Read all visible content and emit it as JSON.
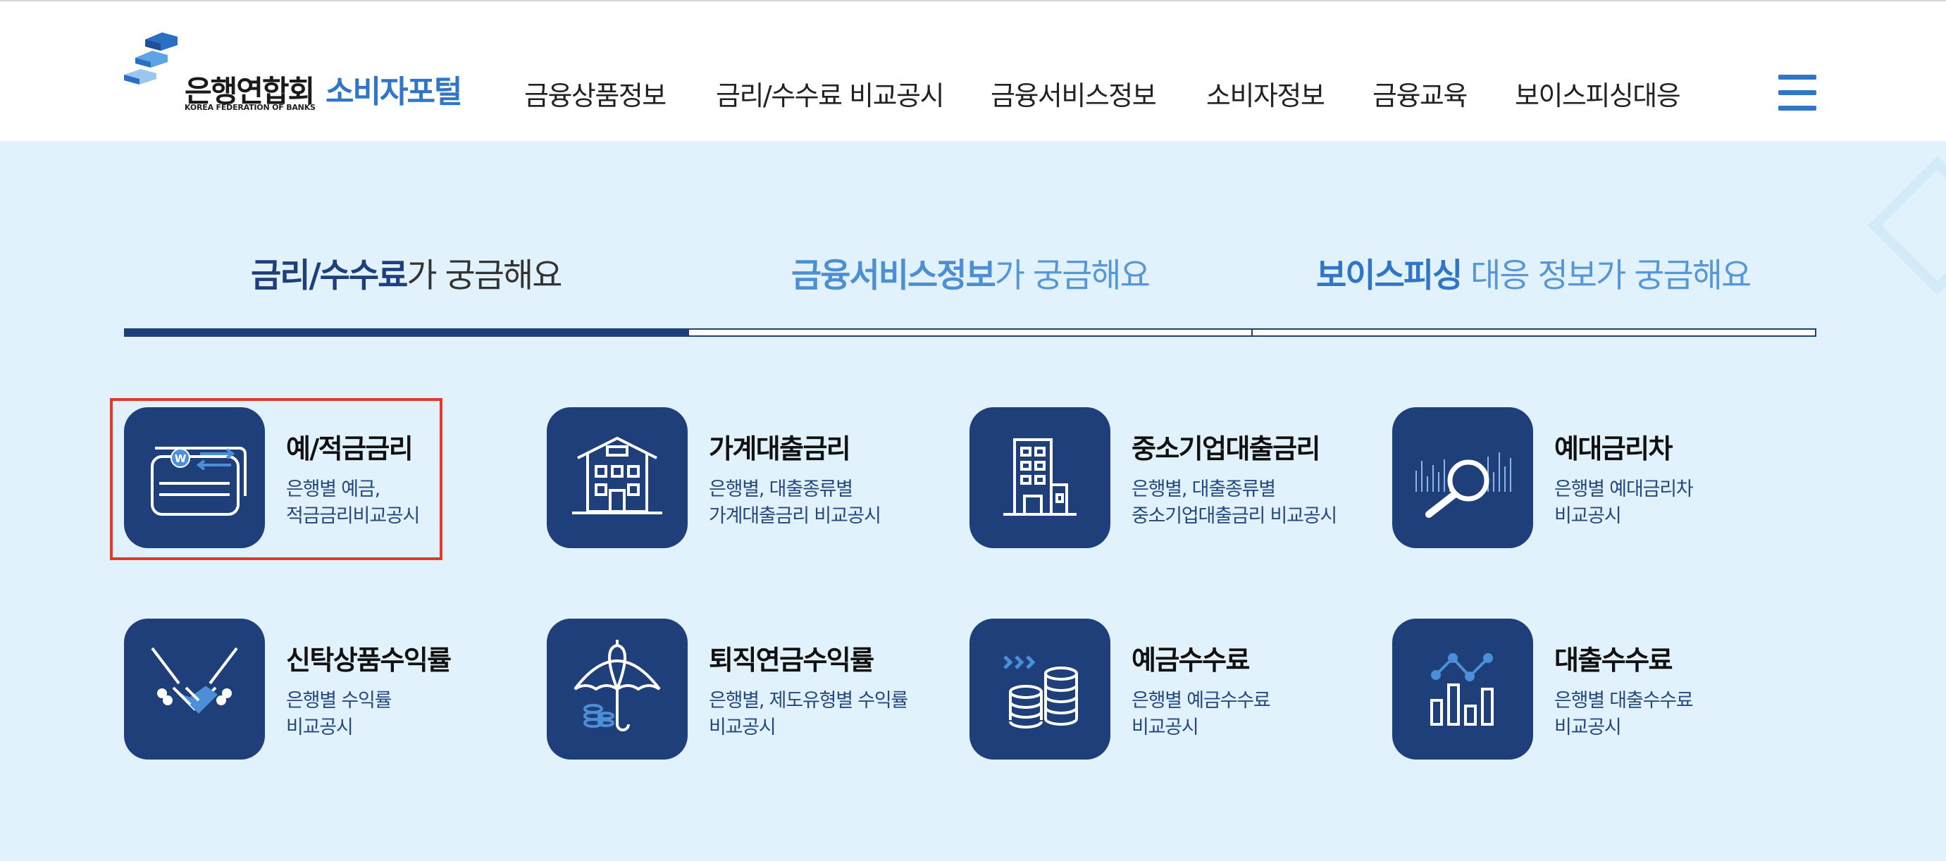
{
  "header": {
    "logo": {
      "name": "은행연합회",
      "subtitle": "KOREA FEDERATION OF BANKS",
      "portal": "소비자포털"
    },
    "nav": [
      "금융상품정보",
      "금리/수수료 비교공시",
      "금융서비스정보",
      "소비자정보",
      "금융교육",
      "보이스피싱대응"
    ],
    "menu_icon": "hamburger-icon"
  },
  "tabs": [
    {
      "bold": "금리/수수료",
      "rest": "가 궁금해요",
      "active": true
    },
    {
      "bold": "금융서비스정보",
      "rest": "가 궁금해요",
      "active": false
    },
    {
      "bold": "보이스피싱",
      "rest": " 대응 정보가 궁금해요",
      "active": false
    }
  ],
  "cards": [
    {
      "title": "예/적금금리",
      "desc1": "은행별 예금,",
      "desc2": "적금금리비교공시",
      "icon": "deposit-card-icon"
    },
    {
      "title": "가계대출금리",
      "desc1": "은행별, 대출종류별",
      "desc2": "가계대출금리 비교공시",
      "icon": "house-icon"
    },
    {
      "title": "중소기업대출금리",
      "desc1": "은행별, 대출종류별",
      "desc2": "중소기업대출금리 비교공시",
      "icon": "building-icon"
    },
    {
      "title": "예대금리차",
      "desc1": "은행별 예대금리차",
      "desc2": "비교공시",
      "icon": "magnifier-chart-icon"
    },
    {
      "title": "신탁상품수익률",
      "desc1": "은행별 수익률",
      "desc2": "비교공시",
      "icon": "handshake-icon"
    },
    {
      "title": "퇴직연금수익률",
      "desc1": "은행별, 제도유형별 수익률",
      "desc2": "비교공시",
      "icon": "umbrella-coins-icon"
    },
    {
      "title": "예금수수료",
      "desc1": "은행별 예금수수료",
      "desc2": "비교공시",
      "icon": "coin-stack-icon"
    },
    {
      "title": "대출수수료",
      "desc1": "은행별 대출수수료",
      "desc2": "비교공시",
      "icon": "bar-line-chart-icon"
    }
  ],
  "colors": {
    "brand_blue": "#2f76c8",
    "navy": "#1f3f7b",
    "background": "#e2f2fc",
    "highlight": "#e0392b"
  }
}
